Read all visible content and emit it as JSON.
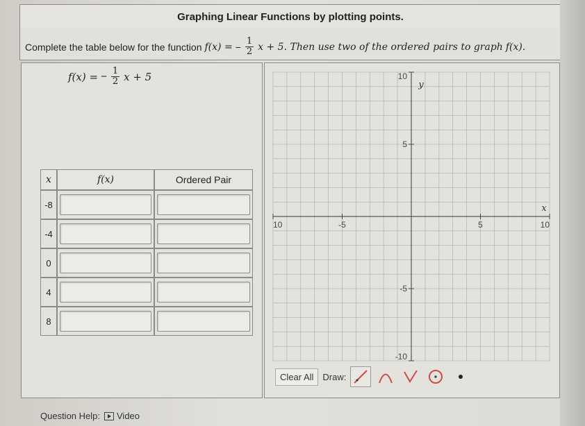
{
  "header": {
    "title": "Graphing Linear Functions by plotting points."
  },
  "prompt": {
    "lead": "Complete the table below for the function",
    "func": "f(x) =",
    "sign": "−",
    "num": "1",
    "den": "2",
    "tail": "x + 5. Then use two of the ordered pairs to graph",
    "end": "f(x)."
  },
  "formula": {
    "lhs": "f(x) =",
    "sign": "−",
    "num": "1",
    "den": "2",
    "rhs": "x + 5"
  },
  "table": {
    "headers": [
      "x",
      "f(x)",
      "Ordered Pair"
    ],
    "rows": [
      {
        "x": "-8",
        "fx": "",
        "pair": ""
      },
      {
        "x": "-4",
        "fx": "",
        "pair": ""
      },
      {
        "x": "0",
        "fx": "",
        "pair": ""
      },
      {
        "x": "4",
        "fx": "",
        "pair": ""
      },
      {
        "x": "8",
        "fx": "",
        "pair": ""
      }
    ]
  },
  "graph": {
    "x_label": "x",
    "y_label": "y",
    "x_min": -10,
    "x_max": 10,
    "y_min": -10,
    "y_max": 10,
    "x_ticks": [
      "10",
      "-5",
      "5",
      "10"
    ],
    "y_ticks": [
      "10",
      "5",
      "-5",
      "-10"
    ]
  },
  "toolbar": {
    "clear_label": "Clear All",
    "draw_label": "Draw:",
    "tools": [
      "line-tool-icon",
      "parabola-tool-icon",
      "absolute-value-tool-icon",
      "circle-tool-icon",
      "point-tool-icon"
    ]
  },
  "help": {
    "label": "Question Help:",
    "video_label": "Video"
  }
}
